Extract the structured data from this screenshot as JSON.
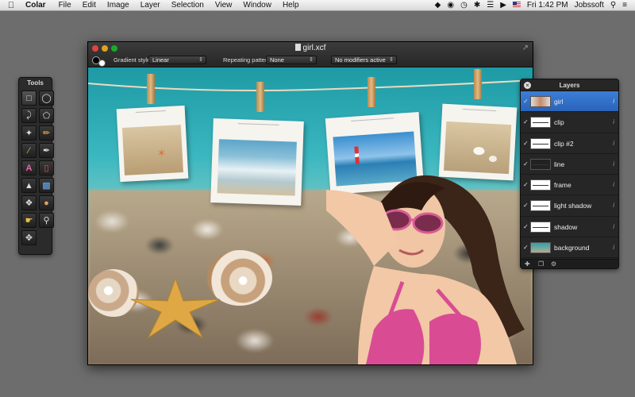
{
  "menubar": {
    "apple_icon": "apple-icon",
    "app_name": "Colar",
    "items": [
      "File",
      "Edit",
      "Image",
      "Layer",
      "Selection",
      "View",
      "Window",
      "Help"
    ],
    "status": {
      "time": "Fri 1:42 PM",
      "user": "Jobssoft",
      "icons": [
        "dropbox-icon",
        "evernote-icon",
        "time-machine-icon",
        "bluetooth-icon",
        "wifi-icon",
        "volume-icon",
        "flag-icon",
        "search-icon",
        "list-icon"
      ]
    }
  },
  "tools_panel": {
    "title": "Tools",
    "tools": [
      "rect-select-icon",
      "ellipse-select-icon",
      "lasso-icon",
      "polygon-lasso-icon",
      "magic-wand-icon",
      "pencil-icon",
      "brush-icon",
      "eyedropper-icon",
      "text-icon",
      "eraser-icon",
      "paint-bucket-icon",
      "gradient-icon",
      "clone-stamp-icon",
      "person-icon",
      "smudge-icon",
      "zoom-icon",
      "move-icon"
    ]
  },
  "document": {
    "title": "girl.xcf",
    "options": {
      "gradient_style_label": "Gradient style:",
      "gradient_style_value": "Linear",
      "repeating_pattern_label": "Repeating pattern:",
      "repeating_pattern_value": "None",
      "modifiers_value": "No modifiers active"
    }
  },
  "layers_panel": {
    "title": "Layers",
    "layers": [
      {
        "name": "girl",
        "selected": true,
        "visible": true
      },
      {
        "name": "clip",
        "selected": false,
        "visible": true
      },
      {
        "name": "clip #2",
        "selected": false,
        "visible": true
      },
      {
        "name": "line",
        "selected": false,
        "visible": true
      },
      {
        "name": "frame",
        "selected": false,
        "visible": true
      },
      {
        "name": "light shadow",
        "selected": false,
        "visible": true
      },
      {
        "name": "shadow",
        "selected": false,
        "visible": true
      },
      {
        "name": "background",
        "selected": false,
        "visible": true
      }
    ]
  },
  "colors": {
    "selection": "#2f6fcb",
    "panel_bg": "#262626",
    "desktop": "#6d6d6d"
  }
}
